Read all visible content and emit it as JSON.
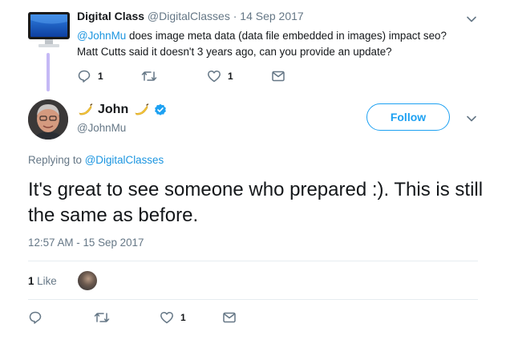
{
  "parent_tweet": {
    "author_name": "Digital Class",
    "author_handle": "@DigitalClasses",
    "separator": "·",
    "date": "14 Sep 2017",
    "mention": "@JohnMu",
    "body": " does image meta data (data file embedded in images) impact seo? Matt Cutts said it doesn't 3 years ago, can you provide an update?",
    "reply_count": "1",
    "retweet_count": "",
    "like_count": "1"
  },
  "main_tweet": {
    "author_name": "John",
    "author_handle": "@JohnMu",
    "follow_label": "Follow",
    "replying_prefix": "Replying to ",
    "replying_to": "@DigitalClasses",
    "text": "It's great to see someone who prepared :). This is still the same as before.",
    "timestamp": "12:57 AM - 15 Sep 2017",
    "likes_number": "1",
    "likes_word": " Like",
    "like_count": "1"
  },
  "colors": {
    "accent": "#1da1f2",
    "link": "#1b95e0",
    "muted": "#657786",
    "thread_line": "#c5b9f5"
  },
  "icons": [
    "reply-icon",
    "retweet-icon",
    "heart-icon",
    "message-icon",
    "chevron-down-icon",
    "verified-icon",
    "banana-emoji-icon"
  ]
}
